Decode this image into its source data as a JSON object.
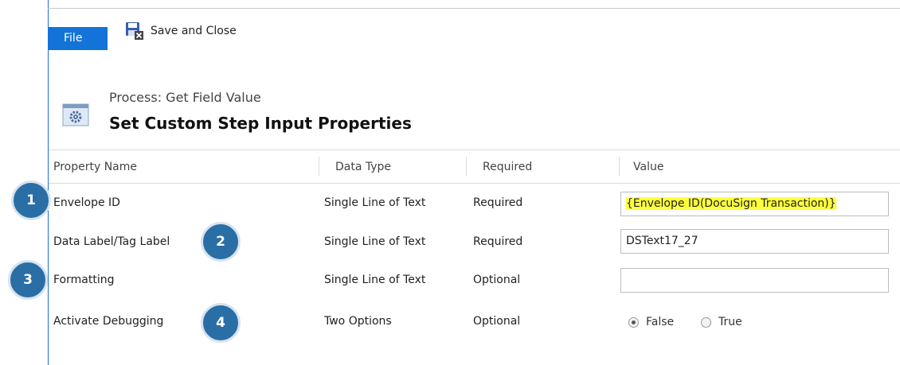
{
  "ribbon": {
    "file_tab": "File",
    "save_close": "Save and Close"
  },
  "header": {
    "subtitle": "Process: Get Field Value",
    "title": "Set Custom Step Input Properties"
  },
  "table": {
    "columns": [
      "Property Name",
      "Data Type",
      "Required",
      "Value"
    ],
    "rows": [
      {
        "name": "Envelope ID",
        "type": "Single Line of Text",
        "required": "Required",
        "value": "{Envelope ID(DocuSign Transaction)}"
      },
      {
        "name": "Data Label/Tag Label",
        "type": "Single Line of Text",
        "required": "Required",
        "value": "DSText17_27"
      },
      {
        "name": "Formatting",
        "type": "Single Line of Text",
        "required": "Optional",
        "value": ""
      },
      {
        "name": "Activate Debugging",
        "type": "Two Options",
        "required": "Optional",
        "options": [
          "False",
          "True"
        ],
        "selected": "False"
      }
    ]
  },
  "callouts": [
    "1",
    "2",
    "3",
    "4"
  ],
  "colors": {
    "accent": "#1373d9",
    "badge": "#2a6ea6",
    "highlight": "#ffff3d"
  }
}
